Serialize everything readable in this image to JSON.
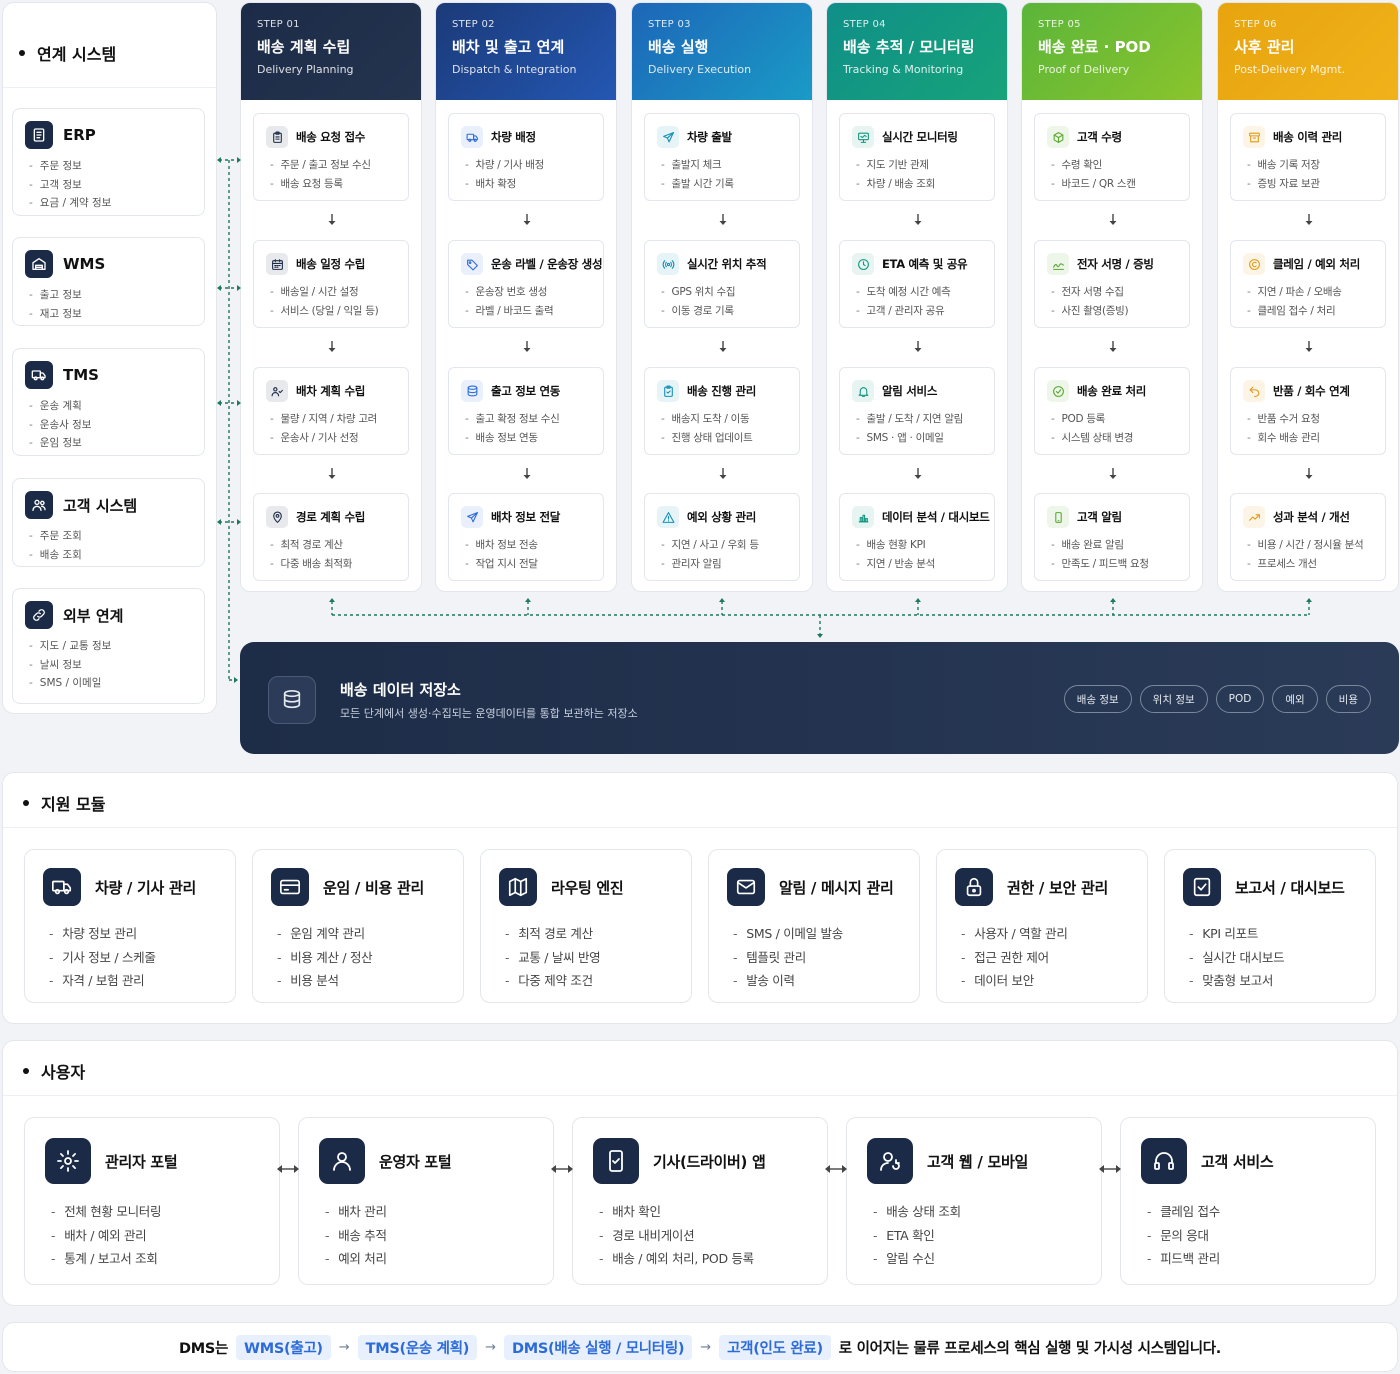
{
  "systems": {
    "title": "연계 시스템",
    "items": [
      {
        "name": "ERP",
        "icon": "document-icon",
        "lines": [
          "주문 정보",
          "고객 정보",
          "요금 / 계약 정보"
        ]
      },
      {
        "name": "WMS",
        "icon": "warehouse-icon",
        "lines": [
          "출고 정보",
          "재고 정보"
        ]
      },
      {
        "name": "TMS",
        "icon": "truck-icon",
        "lines": [
          "운송 계획",
          "운송사 정보",
          "운임 정보"
        ]
      },
      {
        "name": "고객 시스템",
        "icon": "users-icon",
        "lines": [
          "주문 조회",
          "배송 조회"
        ]
      },
      {
        "name": "외부 연계",
        "icon": "link-icon",
        "lines": [
          "지도 / 교통 정보",
          "날씨 정보",
          "SMS / 이메일"
        ]
      }
    ]
  },
  "steps": [
    {
      "num": "STEP 01",
      "title": "배송 계획 수립",
      "sub": "Delivery Planning",
      "color": "#1c2b47",
      "color2": "#24344f",
      "accent": "#1c2b47",
      "boxes": [
        {
          "title": "배송 요청 접수",
          "icon": "clipboard-icon",
          "lines": [
            "주문 / 출고 정보 수신",
            "배송 요청 등록"
          ]
        },
        {
          "title": "배송 일정 수립",
          "icon": "calendar-icon",
          "lines": [
            "배송일 / 시간 설정",
            "서비스 (당일 / 익일 등)"
          ]
        },
        {
          "title": "배차 계획 수립",
          "icon": "people-icon",
          "lines": [
            "물량 / 지역 / 차량 고려",
            "운송사 / 기사 선정"
          ]
        },
        {
          "title": "경로 계획 수립",
          "icon": "pin-icon",
          "lines": [
            "최적 경로 계산",
            "다중 배송 최적화"
          ]
        }
      ]
    },
    {
      "num": "STEP 02",
      "title": "배차 및 출고 연계",
      "sub": "Dispatch & Integration",
      "color": "#1b3a78",
      "color2": "#2457b3",
      "accent": "#2d6bd8",
      "boxes": [
        {
          "title": "차량 배정",
          "icon": "truck-icon",
          "lines": [
            "차량 / 기사 배정",
            "배차 확정"
          ]
        },
        {
          "title": "운송 라벨 / 운송장 생성",
          "icon": "tag-icon",
          "lines": [
            "운송장 번호 생성",
            "라벨 / 바코드 출력"
          ]
        },
        {
          "title": "출고 정보 연동",
          "icon": "database-icon",
          "lines": [
            "출고 확정 정보 수신",
            "배송 정보 연동"
          ]
        },
        {
          "title": "배차 정보 전달",
          "icon": "send-icon",
          "lines": [
            "배차 정보 전송",
            "작업 지시 전달"
          ]
        }
      ]
    },
    {
      "num": "STEP 03",
      "title": "배송 실행",
      "sub": "Delivery Execution",
      "color": "#1d66b8",
      "color2": "#1a9bc6",
      "accent": "#138fb5",
      "boxes": [
        {
          "title": "차량 출발",
          "icon": "send-icon",
          "lines": [
            "출발지 체크",
            "출발 시간 기록"
          ]
        },
        {
          "title": "실시간 위치 추적",
          "icon": "signal-icon",
          "lines": [
            "GPS 위치 수집",
            "이동 경로 기록"
          ]
        },
        {
          "title": "배송 진행 관리",
          "icon": "clipboard-check-icon",
          "lines": [
            "배송지 도착 / 이동",
            "진행 상태 업데이트"
          ]
        },
        {
          "title": "예외 상황 관리",
          "icon": "warning-icon",
          "lines": [
            "지연 / 사고 / 우회 등",
            "관리자 알림"
          ]
        }
      ]
    },
    {
      "num": "STEP 04",
      "title": "배송 추적 / 모니터링",
      "sub": "Tracking & Monitoring",
      "color": "#0f8f88",
      "color2": "#17a37a",
      "accent": "#12977f",
      "boxes": [
        {
          "title": "실시간 모니터링",
          "icon": "monitor-icon",
          "lines": [
            "지도 기반 관제",
            "차량 / 배송 조회"
          ]
        },
        {
          "title": "ETA 예측 및 공유",
          "icon": "clock-icon",
          "lines": [
            "도착 예정 시간 예측",
            "고객 / 관리자 공유"
          ]
        },
        {
          "title": "알림 서비스",
          "icon": "bell-icon",
          "lines": [
            "출발 / 도착 / 지연 알림",
            "SMS · 앱 · 이메일"
          ]
        },
        {
          "title": "데이터 분석 / 대시보드",
          "icon": "chart-icon",
          "lines": [
            "배송 현황 KPI",
            "지연 / 반송 분석"
          ]
        }
      ]
    },
    {
      "num": "STEP 05",
      "title": "배송 완료 · POD",
      "sub": "Proof of Delivery",
      "color": "#5bb53a",
      "color2": "#8ac42c",
      "accent": "#58a82f",
      "boxes": [
        {
          "title": "고객 수령",
          "icon": "box-icon",
          "lines": [
            "수령 확인",
            "바코드 / QR 스캔"
          ]
        },
        {
          "title": "전자 서명 / 증빙",
          "icon": "signature-icon",
          "lines": [
            "전자 서명 수집",
            "사진 촬영(증빙)"
          ]
        },
        {
          "title": "배송 완료 처리",
          "icon": "check-circle-icon",
          "lines": [
            "POD 등록",
            "시스템 상태 변경"
          ]
        },
        {
          "title": "고객 알림",
          "icon": "phone-icon",
          "lines": [
            "배송 완료 알림",
            "만족도 / 피드백 요청"
          ]
        }
      ]
    },
    {
      "num": "STEP 06",
      "title": "사후 관리",
      "sub": "Post-Delivery Mgmt.",
      "color": "#e7a40e",
      "color2": "#f0b21a",
      "accent": "#e29a10",
      "boxes": [
        {
          "title": "배송 이력 관리",
          "icon": "archive-icon",
          "lines": [
            "배송 기록 저장",
            "증빙 자료 보관"
          ]
        },
        {
          "title": "클레임 / 예외 처리",
          "icon": "claim-icon",
          "lines": [
            "지연 / 파손 / 오배송",
            "클레임 접수 / 처리"
          ]
        },
        {
          "title": "반품 / 회수 연계",
          "icon": "return-icon",
          "lines": [
            "반품 수거 요청",
            "회수 배송 관리"
          ]
        },
        {
          "title": "성과 분석 / 개선",
          "icon": "trend-icon",
          "lines": [
            "비용 / 시간 / 정시율 분석",
            "프로세스 개선"
          ]
        }
      ]
    }
  ],
  "storage": {
    "title": "배송 데이터 저장소",
    "desc": "모든 단계에서 생성·수집되는 운영데이터를 통합 보관하는 저장소",
    "tags": [
      "배송 정보",
      "위치 정보",
      "POD",
      "예외",
      "비용"
    ]
  },
  "support": {
    "title": "지원 모듈",
    "items": [
      {
        "title": "차량 / 기사 관리",
        "icon": "truck-icon",
        "lines": [
          "차량 정보 관리",
          "기사 정보 / 스케줄",
          "자격 / 보험 관리"
        ]
      },
      {
        "title": "운임 / 비용 관리",
        "icon": "card-icon",
        "lines": [
          "운임 계약 관리",
          "비용 계산 / 정산",
          "비용 분석"
        ]
      },
      {
        "title": "라우팅 엔진",
        "icon": "map-icon",
        "lines": [
          "최적 경로 계산",
          "교통 / 날씨 반영",
          "다중 제약 조건"
        ]
      },
      {
        "title": "알림 / 메시지 관리",
        "icon": "mail-icon",
        "lines": [
          "SMS / 이메일 발송",
          "템플릿 관리",
          "발송 이력"
        ]
      },
      {
        "title": "권한 / 보안 관리",
        "icon": "lock-icon",
        "lines": [
          "사용자 / 역할 관리",
          "접근 권한 제어",
          "데이터 보안"
        ]
      },
      {
        "title": "보고서 / 대시보드",
        "icon": "report-icon",
        "lines": [
          "KPI 리포트",
          "실시간 대시보드",
          "맞춤형 보고서"
        ]
      }
    ]
  },
  "users": {
    "title": "사용자",
    "items": [
      {
        "title": "관리자 포털",
        "icon": "settings-icon",
        "lines": [
          "전체 현황 모니터링",
          "배차 / 예외 관리",
          "통계 / 보고서 조회"
        ]
      },
      {
        "title": "운영자 포털",
        "icon": "user-icon",
        "lines": [
          "배차 관리",
          "배송 추적",
          "예외 처리"
        ]
      },
      {
        "title": "기사(드라이버) 앱",
        "icon": "mobile-check-icon",
        "lines": [
          "배차 확인",
          "경로 내비게이션",
          "배송 / 예외 처리, POD 등록"
        ]
      },
      {
        "title": "고객 웹 / 모바일",
        "icon": "user-refresh-icon",
        "lines": [
          "배송 상태 조회",
          "ETA 확인",
          "알림 수신"
        ]
      },
      {
        "title": "고객 서비스",
        "icon": "headset-icon",
        "lines": [
          "클레임 접수",
          "문의 응대",
          "피드백 관리"
        ]
      }
    ]
  },
  "bottom": {
    "prefix": "DMS는",
    "chips": [
      "WMS(출고)",
      "TMS(운송 계획)",
      "DMS(배송 실행 / 모니터링)",
      "고객(인도 완료)"
    ],
    "suffix": "로 이어지는 물류 프로세스의 핵심 실행 및 가시성 시스템입니다."
  }
}
